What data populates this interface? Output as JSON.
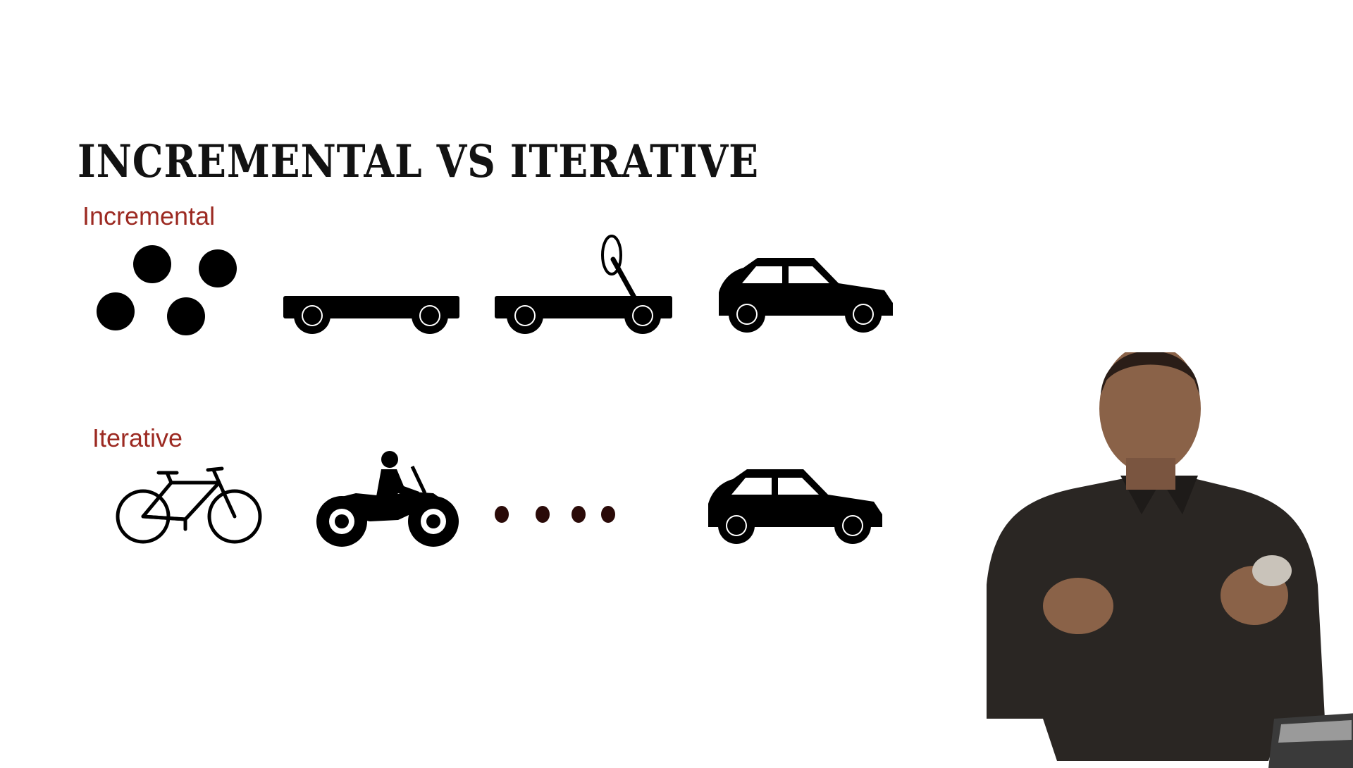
{
  "slide": {
    "title": "INCREMENTAL VS ITERATIVE",
    "incremental_label": "Incremental",
    "iterative_label": "Iterative"
  },
  "icons": {
    "incremental": [
      "bubbles-icon",
      "chassis-icon",
      "steering-chassis-icon",
      "car-icon"
    ],
    "iterative": [
      "bicycle-icon",
      "motorcycle-icon",
      "ellipsis-dots-icon",
      "car-icon"
    ]
  },
  "colors": {
    "title": "#121212",
    "label": "#9c2a22",
    "icon": "#000000",
    "dots": "#2a0a08",
    "background": "#ffffff"
  }
}
